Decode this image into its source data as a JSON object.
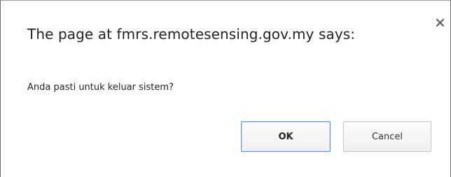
{
  "dialog": {
    "title": "The page at fmrs.remotesensing.gov.my says:",
    "message": "Anda pasti untuk keluar sistem?",
    "close_icon": "close-icon",
    "buttons": {
      "ok_label": "OK",
      "cancel_label": "Cancel"
    },
    "colors": {
      "focus_border": "#4d90fe",
      "text": "#222222"
    }
  }
}
